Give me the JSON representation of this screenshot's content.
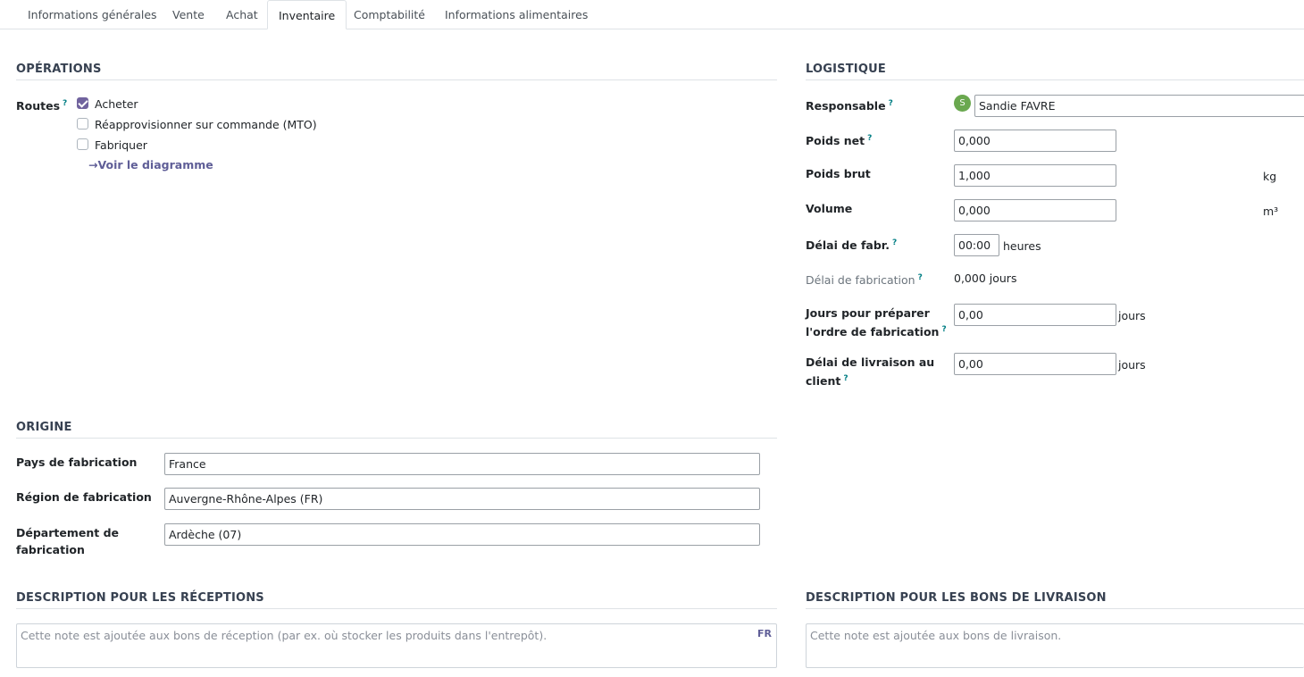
{
  "tabs": [
    {
      "label": "Informations générales"
    },
    {
      "label": "Vente"
    },
    {
      "label": "Achat"
    },
    {
      "label": "Inventaire"
    },
    {
      "label": "Comptabilité"
    },
    {
      "label": "Informations alimentaires"
    }
  ],
  "active_tab": "Inventaire",
  "operations": {
    "title": "OPÉRATIONS",
    "routes_label": "Routes",
    "routes": [
      {
        "label": "Acheter",
        "checked": true
      },
      {
        "label": "Réapprovisionner sur commande (MTO)",
        "checked": false
      },
      {
        "label": "Fabriquer",
        "checked": false
      }
    ],
    "diagram_link": "Voir le diagramme"
  },
  "logistics": {
    "title": "LOGISTIQUE",
    "responsible_label": "Responsable",
    "responsible_avatar": "S",
    "responsible_value": "Sandie FAVRE",
    "net_weight_label": "Poids net",
    "net_weight_value": "0,000",
    "gross_weight_label": "Poids brut",
    "gross_weight_value": "1,000",
    "gross_weight_unit": "kg",
    "volume_label": "Volume",
    "volume_value": "0,000",
    "volume_unit": "m³",
    "manuf_lead_label": "Délai de fabr.",
    "manuf_lead_value": "00:00",
    "manuf_lead_unit": "heures",
    "manuf_delay_label": "Délai de fabrication",
    "manuf_delay_value": "0,000 jours",
    "prep_days_label_1": "Jours pour préparer",
    "prep_days_label_2": "l'ordre de fabrication",
    "prep_days_value": "0,00",
    "prep_days_unit": "jours",
    "delivery_label_1": "Délai de livraison au",
    "delivery_label_2": "client",
    "delivery_value": "0,00",
    "delivery_unit": "jours"
  },
  "origin": {
    "title": "ORIGINE",
    "country_label": "Pays de fabrication",
    "country_value": "France",
    "region_label": "Région de fabrication",
    "region_value": "Auvergne-Rhône-Alpes (FR)",
    "department_label_1": "Département de",
    "department_label_2": "fabrication",
    "department_value": "Ardèche (07)"
  },
  "receipts": {
    "title": "DESCRIPTION POUR LES RÉCEPTIONS",
    "placeholder": "Cette note est ajoutée aux bons de réception (par ex. où stocker les produits dans l'entrepôt).",
    "lang": "FR"
  },
  "deliveries": {
    "title": "DESCRIPTION POUR LES BONS DE LIVRAISON",
    "placeholder": "Cette note est ajoutée aux bons de livraison."
  },
  "help_marker": "?",
  "arrow_glyph": "→",
  "colors": {
    "accent": "#71639e",
    "link": "#5f5e97",
    "avatar": "#6aa84f",
    "help": "#017e84"
  }
}
